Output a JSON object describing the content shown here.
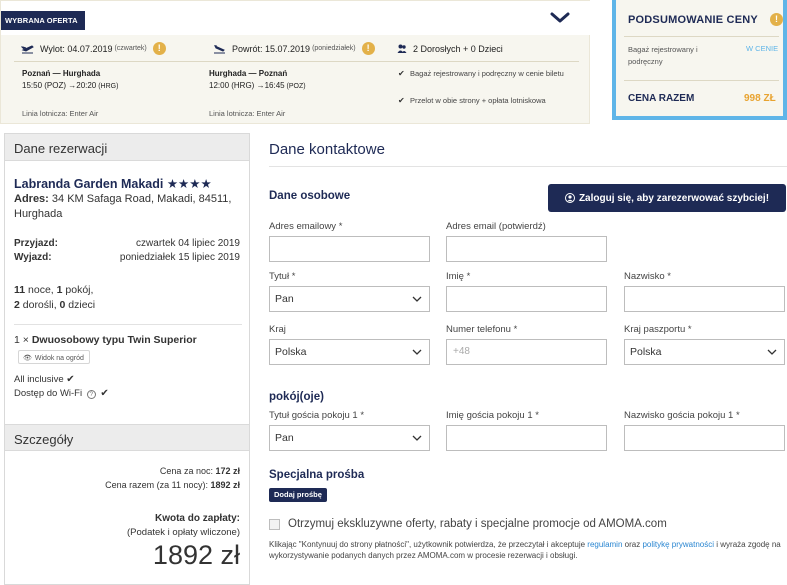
{
  "offer": {
    "badge": "WYBRANA OFERTA",
    "outbound": {
      "label": "Wylot: 04.07.2019",
      "day": "(czwartek)",
      "route": "Poznań — Hurghada",
      "time_main": "15:50 (POZ) →20:20",
      "time_tail": " (HRG)",
      "airline": "Linia lotnicza: Enter Air"
    },
    "return": {
      "label": "Powrót: 15.07.2019",
      "day": "(poniedziałek)",
      "route": "Hurghada — Poznań",
      "time_main": "12:00 (HRG) →16:45",
      "time_tail": " (POZ)",
      "airline": "Linia lotnicza: Enter Air"
    },
    "passengers": "2 Dorosłych + 0 Dzieci",
    "bullets": [
      "Bagaż rejestrowany i podręczny w cenie biletu",
      "Przelot w obie strony + opłata lotniskowa"
    ]
  },
  "price_summary": {
    "title": "PODSUMOWANIE CENY",
    "baggage_label": "Bagaż rejestrowany i podręczny",
    "baggage_value": "W CENIE",
    "total_label": "CENA RAZEM",
    "total_value": "998 ZŁ"
  },
  "reservation": {
    "header": "Dane rezerwacji",
    "hotel_name": "Labranda Garden Makadi ★★★★",
    "address_label": "Adres:",
    "address": " 34 KM Safaga Road, Makadi, 84511, Hurghada",
    "arrival_label": "Przyjazd:",
    "arrival_value": "czwartek 04 lipiec 2019",
    "departure_label": "Wyjazd:",
    "departure_value": "poniedziałek 15 lipiec 2019",
    "nights_num": "11",
    "nights_text": " noce, ",
    "rooms_num": "1",
    "rooms_text": " pokój,",
    "adults_num": "2",
    "adults_text": " dorośli, ",
    "children_num": "0",
    "children_text": " dzieci",
    "room_qty": "1 × ",
    "room_type": "Dwuosobowy typu Twin Superior",
    "view_tag": "Widok na ogród",
    "board": "All inclusive",
    "wifi": "Dostęp do Wi-Fi"
  },
  "details": {
    "header": "Szczegóły",
    "per_night_label": "Cena za noc: ",
    "per_night_value": "172 zł",
    "total_label": "Cena razem (za 11 nocy): ",
    "total_value": "1892 zł",
    "pay_label": "Kwota do zapłaty:",
    "pay_sub": "(Podatek i opłaty wliczone)",
    "pay_amount": "1892 zł"
  },
  "contact": {
    "title": "Dane kontaktowe",
    "personal_heading": "Dane osobowe",
    "login_button": "Zaloguj się, aby zarezerwować szybciej!",
    "email_label": "Adres emailowy *",
    "email_confirm_label": "Adres email (potwierdź)",
    "title_label": "Tytuł *",
    "title_value": "Pan",
    "first_name_label": "Imię *",
    "last_name_label": "Nazwisko *",
    "country_label": "Kraj",
    "country_value": "Polska",
    "phone_label": "Numer telefonu *",
    "phone_placeholder": "+48",
    "passport_label": "Kraj paszportu *",
    "passport_value": "Polska",
    "rooms_heading": "pokój(oje)",
    "guest_title_label": "Tytuł gościa pokoju 1 *",
    "guest_title_value": "Pan",
    "guest_first_label": "Imię gościa pokoju 1 *",
    "guest_last_label": "Nazwisko gościa pokoju 1 *",
    "special_heading": "Specjalna prośba",
    "add_request": "Dodaj prośbę",
    "consent": "Otrzymuj ekskluzywne oferty, rabaty i specjalne promocje od AMOMA.com",
    "legal_1": "Klikając \"Kontynuuj do strony płatności\", użytkownik potwierdza, że przeczytał i akceptuje ",
    "legal_link_1": "regulamin",
    "legal_2": " oraz ",
    "legal_link_2": "politykę prywatności",
    "legal_3": " i wyraża zgodę na wykorzystywanie podanych danych przez AMOMA.com w procesie rezerwacji i obsługi."
  },
  "colors": {
    "navy": "#1e2a55",
    "accent_blue": "#5fb5e8",
    "accent_orange": "#e8a330",
    "link": "#2a86d1"
  }
}
